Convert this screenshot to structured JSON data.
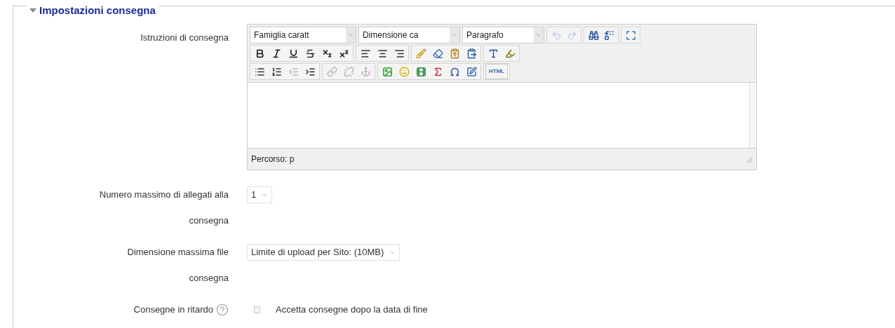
{
  "section": {
    "title": "Impostazioni consegna",
    "expanded": true
  },
  "editor": {
    "label": "Istruzioni di consegna",
    "selects": [
      "Famiglia caratt",
      "Dimensione ca",
      "Paragrafo"
    ],
    "toolbar_rows": [
      [
        [
          {
            "kind": "undo",
            "disabled": true
          },
          {
            "kind": "redo",
            "disabled": true
          }
        ],
        [
          {
            "kind": "find",
            "disabled": false
          },
          {
            "kind": "replace",
            "disabled": false
          }
        ],
        [
          {
            "kind": "fullscreen",
            "disabled": false
          }
        ]
      ],
      [
        [
          {
            "kind": "bold",
            "disabled": false
          },
          {
            "kind": "italic",
            "disabled": false
          },
          {
            "kind": "underline",
            "disabled": false
          },
          {
            "kind": "strike",
            "disabled": false
          },
          {
            "kind": "subscript",
            "disabled": false
          },
          {
            "kind": "superscript",
            "disabled": false
          }
        ],
        [
          {
            "kind": "align-left",
            "disabled": false
          },
          {
            "kind": "align-center",
            "disabled": false
          },
          {
            "kind": "align-right",
            "disabled": false
          }
        ],
        [
          {
            "kind": "clean",
            "disabled": false
          },
          {
            "kind": "eraser",
            "disabled": false
          },
          {
            "kind": "paste-text",
            "disabled": false
          },
          {
            "kind": "paste-word",
            "disabled": false
          }
        ],
        [
          {
            "kind": "text-color",
            "disabled": false
          },
          {
            "kind": "highlight",
            "disabled": false
          }
        ]
      ],
      [
        [
          {
            "kind": "bullets",
            "disabled": false
          },
          {
            "kind": "numbers",
            "disabled": false
          },
          {
            "kind": "outdent",
            "disabled": true
          },
          {
            "kind": "indent",
            "disabled": false
          }
        ],
        [
          {
            "kind": "link",
            "disabled": true
          },
          {
            "kind": "unlink",
            "disabled": true
          },
          {
            "kind": "anchor",
            "disabled": true
          }
        ],
        [
          {
            "kind": "image",
            "disabled": false
          },
          {
            "kind": "emoticon",
            "disabled": false
          },
          {
            "kind": "media",
            "disabled": false
          },
          {
            "kind": "math",
            "disabled": false
          },
          {
            "kind": "omega",
            "disabled": false
          },
          {
            "kind": "edit",
            "disabled": false
          }
        ],
        [
          {
            "kind": "html",
            "label": "HTML",
            "disabled": false
          }
        ]
      ]
    ],
    "path": "Percorso: p"
  },
  "fields": [
    {
      "kind": "select",
      "label": "Numero massimo di allegati alla",
      "label_2": "consegna",
      "value": "1"
    },
    {
      "kind": "select",
      "label": "Dimensione massima file",
      "label_2": "consegna",
      "value": "Limite di upload per Sito: (10MB)"
    },
    {
      "kind": "checkbox",
      "label": "Consegne in ritardo",
      "help": true,
      "checked": false,
      "text": "Accetta consegne dopo la data di fine"
    }
  ]
}
